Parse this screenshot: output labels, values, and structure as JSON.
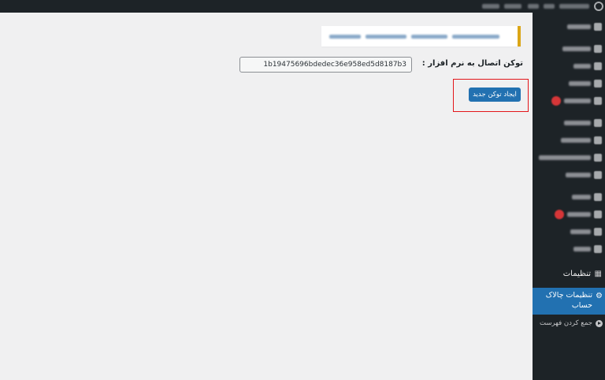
{
  "sidebar": {
    "settings_label": "تنظیمات",
    "settings_icon": "settings-sliders-icon",
    "active_item_label": "تنظیمات چالاک حساب",
    "active_item_icon": "gear-icon",
    "submenu_item_label": "جمع کردن فهرست",
    "submenu_item_icon": "collapse-play-icon"
  },
  "form": {
    "token_label": "توکن اتصال به نرم افزار :",
    "token_value": "1b19475696bdedec36e958ed5d8187b3",
    "create_token_button": "ایجاد توکن جدید"
  },
  "colors": {
    "admin_bar": "#1d2327",
    "accent": "#2271b1",
    "notice_border": "#dba617",
    "highlight_box": "#e3161a",
    "badge": "#d63638"
  }
}
